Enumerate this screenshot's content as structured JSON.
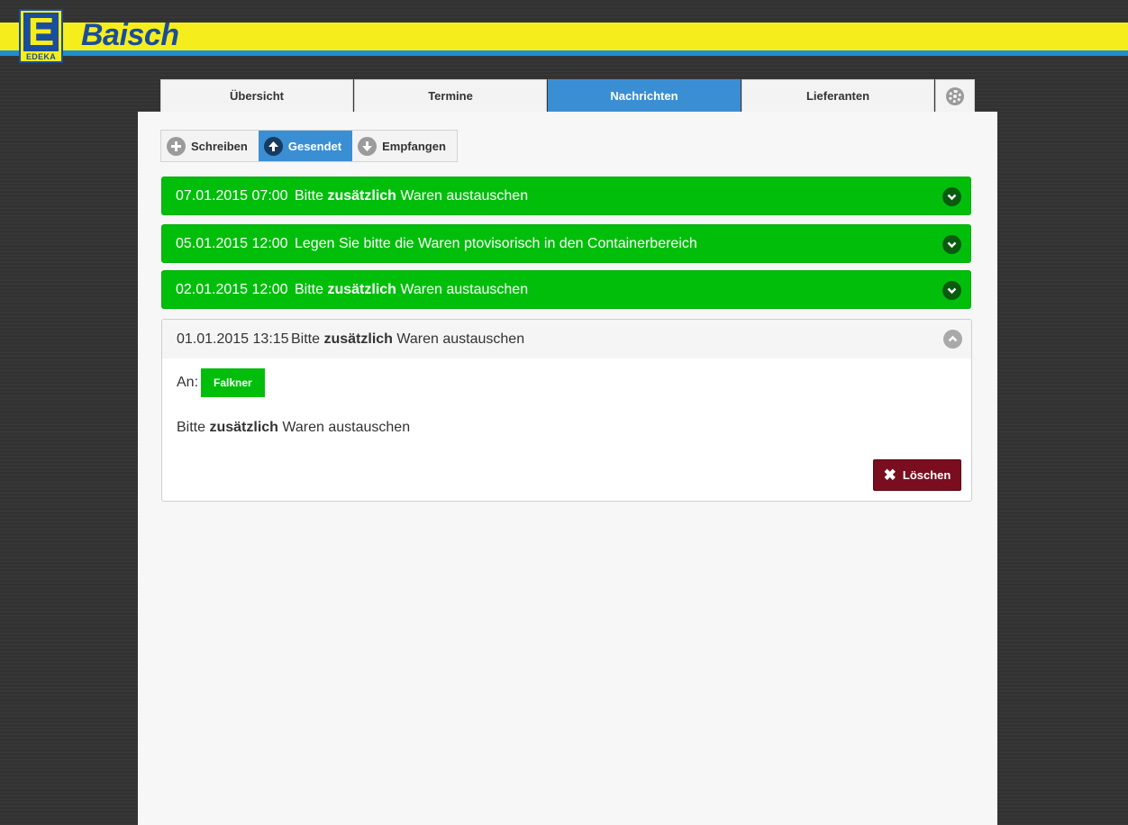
{
  "header": {
    "logo_letter": "E",
    "logo_sub": "EDEKA",
    "brand": "Baisch"
  },
  "tabs": [
    {
      "label": "Übersicht",
      "active": false
    },
    {
      "label": "Termine",
      "active": false
    },
    {
      "label": "Nachrichten",
      "active": true
    },
    {
      "label": "Lieferanten",
      "active": false
    }
  ],
  "subtabs": [
    {
      "label": "Schreiben",
      "icon": "plus-icon",
      "active": false
    },
    {
      "label": "Gesendet",
      "icon": "arrow-up-icon",
      "active": true
    },
    {
      "label": "Empfangen",
      "icon": "arrow-down-icon",
      "active": false
    }
  ],
  "messages": [
    {
      "date": "07.01.2015 07:00",
      "subject_pre": "Bitte ",
      "subject_bold": "zusätzlich",
      "subject_post": " Waren austauschen"
    },
    {
      "date": "05.01.2015 12:00",
      "subject_pre": "Legen Sie bitte die Waren ptovisorisch in den Containerbereich",
      "subject_bold": "",
      "subject_post": ""
    },
    {
      "date": "02.01.2015 12:00",
      "subject_pre": "Bitte ",
      "subject_bold": "zusätzlich",
      "subject_post": " Waren austauschen"
    }
  ],
  "open_message": {
    "date": "01.01.2015 13:15",
    "subject_pre": "Bitte ",
    "subject_bold": "zusätzlich",
    "subject_post": " Waren austauschen",
    "to_label": "An:",
    "recipient": "Falkner",
    "body_pre": "Bitte ",
    "body_bold": "zusätzlich",
    "body_post": " Waren austauschen",
    "delete_label": "Löschen"
  },
  "colors": {
    "accent_blue": "#3a8fd4",
    "message_green": "#01be0b",
    "delete_red": "#7a0d1f",
    "brand_yellow": "#f6ee1c",
    "brand_blue": "#1a4d9b"
  }
}
